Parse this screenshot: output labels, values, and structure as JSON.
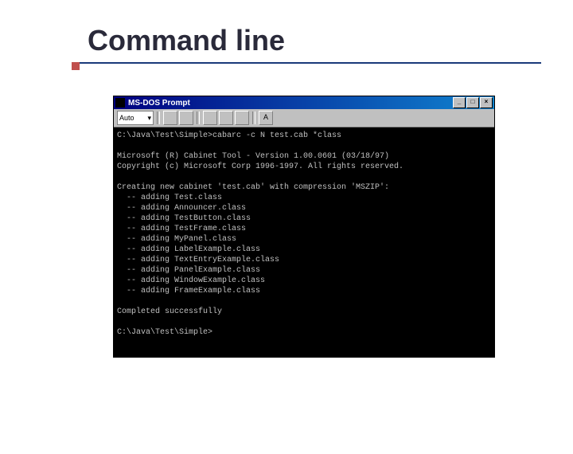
{
  "slide": {
    "title": "Command line"
  },
  "window": {
    "title": "MS-DOS Prompt",
    "buttons": {
      "min": "_",
      "max": "□",
      "close": "×"
    }
  },
  "toolbar": {
    "select": "Auto",
    "arrow": "▾"
  },
  "console": {
    "prompt1": "C:\\Java\\Test\\Simple>cabarc -c N test.cab *class",
    "blank1": "",
    "tool1": "Microsoft (R) Cabinet Tool - Version 1.00.0601 (03/18/97)",
    "tool2": "Copyright (c) Microsoft Corp 1996-1997. All rights reserved.",
    "blank2": "",
    "creating": "Creating new cabinet 'test.cab' with compression 'MSZIP':",
    "a0": "  -- adding Test.class",
    "a1": "  -- adding Announcer.class",
    "a2": "  -- adding TestButton.class",
    "a3": "  -- adding TestFrame.class",
    "a4": "  -- adding MyPanel.class",
    "a5": "  -- adding LabelExample.class",
    "a6": "  -- adding TextEntryExample.class",
    "a7": "  -- adding PanelExample.class",
    "a8": "  -- adding WindowExample.class",
    "a9": "  -- adding FrameExample.class",
    "blank3": "",
    "done": "Completed successfully",
    "blank4": "",
    "prompt2": "C:\\Java\\Test\\Simple>"
  }
}
